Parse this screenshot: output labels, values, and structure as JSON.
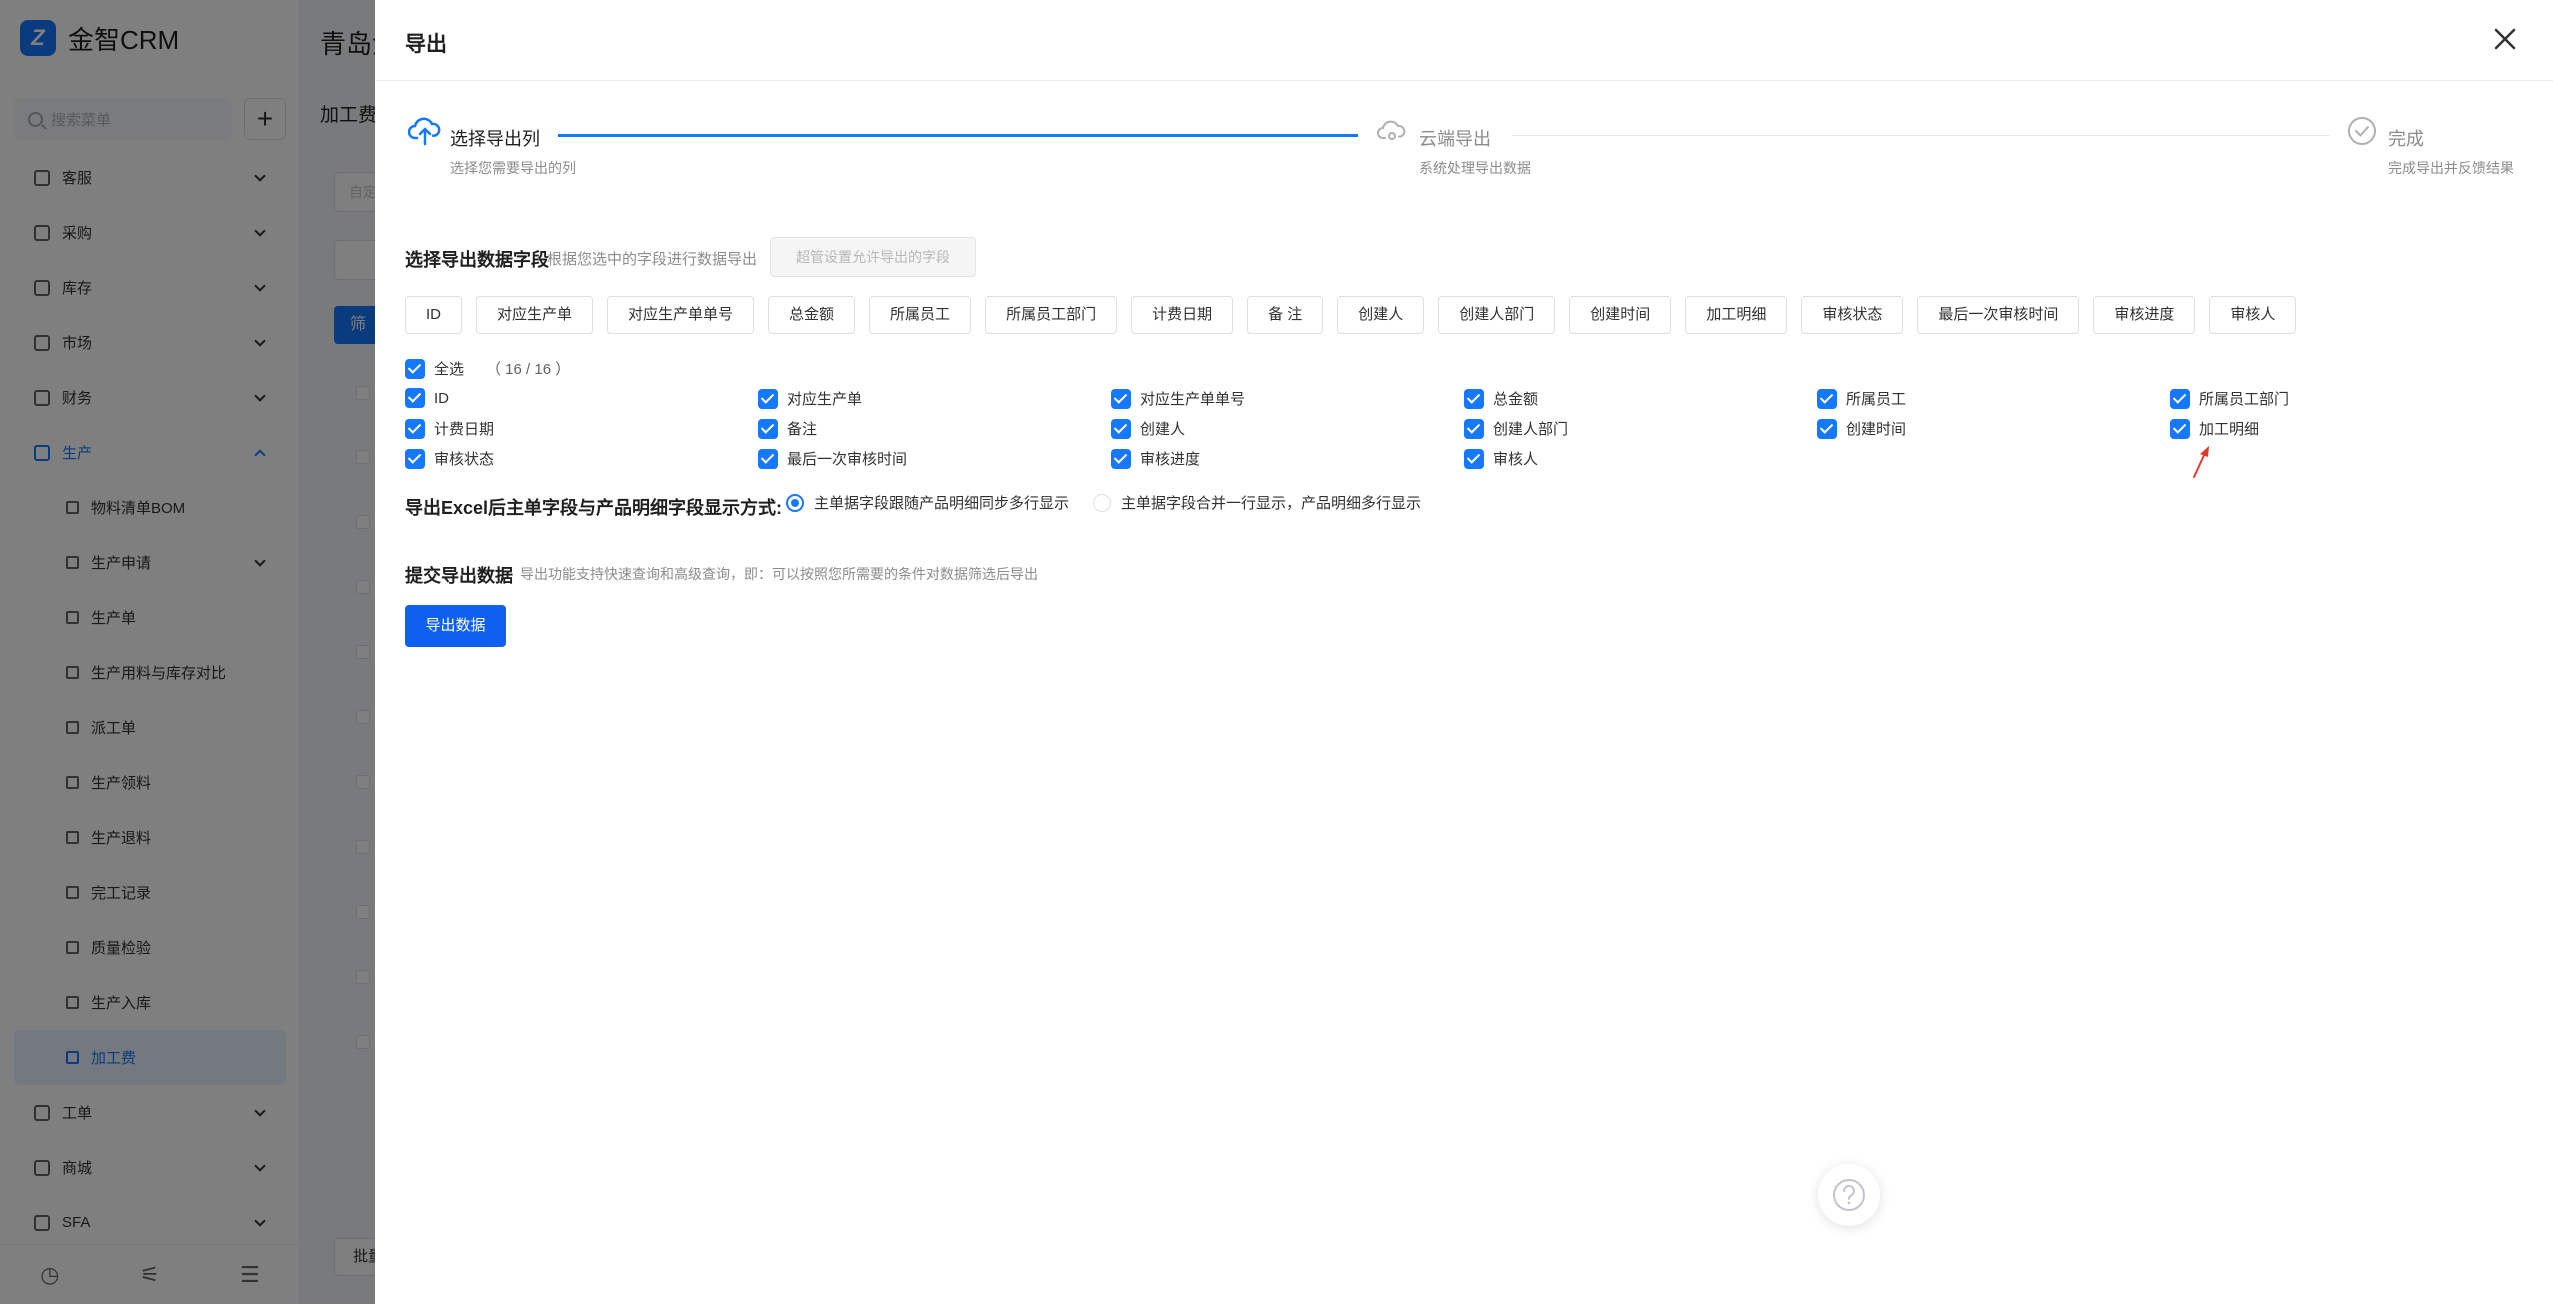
{
  "app": {
    "brand": "金智CRM",
    "search_placeholder": "搜索菜单",
    "add_label": "+"
  },
  "sidebar": {
    "items": [
      {
        "label": "客服"
      },
      {
        "label": "采购"
      },
      {
        "label": "库存"
      },
      {
        "label": "市场"
      },
      {
        "label": "财务"
      },
      {
        "label": "生产"
      }
    ],
    "production_children": [
      {
        "label": "物料清单BOM"
      },
      {
        "label": "生产申请"
      },
      {
        "label": "生产单"
      },
      {
        "label": "生产用料与库存对比"
      },
      {
        "label": "派工单"
      },
      {
        "label": "生产领料"
      },
      {
        "label": "生产退料"
      },
      {
        "label": "完工记录"
      },
      {
        "label": "质量检验"
      },
      {
        "label": "生产入库"
      },
      {
        "label": "加工费"
      }
    ],
    "bottom_items": [
      {
        "label": "工单"
      },
      {
        "label": "商城"
      },
      {
        "label": "SFA"
      }
    ]
  },
  "main": {
    "title": "青岛金",
    "tab": "加工费",
    "input_placeholder": "自定",
    "filter_button": "筛",
    "batch_button": "批量"
  },
  "drawer": {
    "title": "导出",
    "steps": [
      {
        "title": "选择导出列",
        "desc": "选择您需要导出的列"
      },
      {
        "title": "云端导出",
        "desc": "系统处理导出数据"
      },
      {
        "title": "完成",
        "desc": "完成导出并反馈结果"
      }
    ],
    "field_section": {
      "label": "选择导出数据字段",
      "hint": "根据您选中的字段进行数据导出",
      "admin_button": "超管设置允许导出的字段"
    },
    "tags": [
      "ID",
      "对应生产单",
      "对应生产单单号",
      "总金额",
      "所属员工",
      "所属员工部门",
      "计费日期",
      "备 注",
      "创建人",
      "创建人部门",
      "创建时间",
      "加工明细",
      "审核状态",
      "最后一次审核时间",
      "审核进度",
      "审核人"
    ],
    "select_all": {
      "label": "全选",
      "count": "（ 16 / 16 ）"
    },
    "checkboxes": [
      "ID",
      "对应生产单",
      "对应生产单单号",
      "总金额",
      "所属员工",
      "所属员工部门",
      "计费日期",
      "备注",
      "创建人",
      "创建人部门",
      "创建时间",
      "加工明细",
      "审核状态",
      "最后一次审核时间",
      "审核进度",
      "审核人"
    ],
    "display_mode": {
      "label": "导出Excel后主单字段与产品明细字段显示方式:",
      "options": [
        "主单据字段跟随产品明细同步多行显示",
        "主单据字段合并一行显示，产品明细多行显示"
      ],
      "selected": 0
    },
    "submit_section": {
      "label": "提交导出数据",
      "hint": "导出功能支持快速查询和高级查询，即：可以按照您所需要的条件对数据筛选后导出",
      "button": "导出数据"
    }
  },
  "colors": {
    "primary": "#1677ff",
    "overlay": "rgba(0,0,0,0.5)",
    "arrow": "#e5382b"
  }
}
